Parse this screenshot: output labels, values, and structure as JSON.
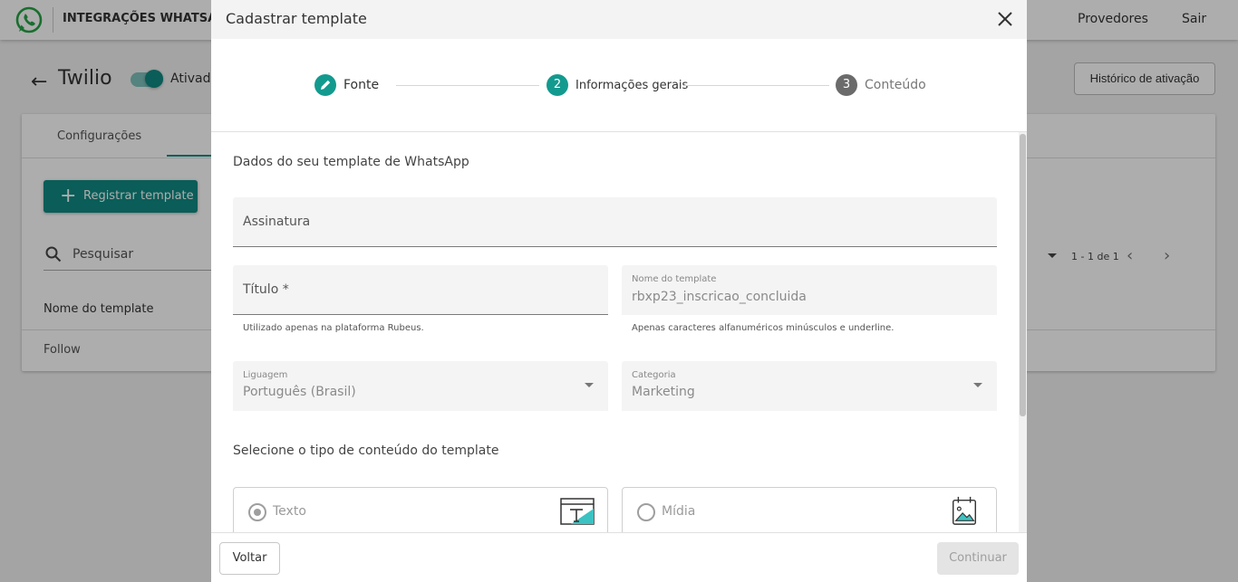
{
  "app": {
    "title": "INTEGRAÇÕES WHATSAPP",
    "nav": {
      "providers": "Provedores",
      "logout": "Sair"
    }
  },
  "provider": {
    "back_icon": "arrow-left-icon",
    "name": "Twilio",
    "status_label": "Ativado",
    "status_on": true,
    "history_button": "Histórico de ativação"
  },
  "card": {
    "tab_config": "Configurações",
    "register_button": "Registrar template",
    "search_placeholder": "Pesquisar",
    "pagination": "1 - 1 de 1",
    "column_header": "Nome do template",
    "rows": [
      "Follow"
    ]
  },
  "modal": {
    "title": "Cadastrar template",
    "steps": [
      {
        "number": "",
        "label": "Fonte",
        "state": "completed",
        "icon": "pencil-icon"
      },
      {
        "number": "2",
        "label": "Informações gerais",
        "state": "active"
      },
      {
        "number": "3",
        "label": "Conteúdo",
        "state": "pending"
      }
    ],
    "section_data_title": "Dados do seu template de WhatsApp",
    "fields": {
      "signature": {
        "placeholder": "Assinatura"
      },
      "title": {
        "placeholder": "Título *",
        "hint": "Utilizado apenas na plataforma Rubeus."
      },
      "template_name": {
        "label": "Nome do template",
        "value": "rbxp23_inscricao_concluida",
        "hint": "Apenas caracteres alfanuméricos minúsculos e underline."
      },
      "language": {
        "label": "Liguagem",
        "value": "Português (Brasil)"
      },
      "category": {
        "label": "Categoria",
        "value": "Marketing"
      }
    },
    "content_section_title": "Selecione o tipo de conteúdo do template",
    "content_options": [
      {
        "label": "Texto",
        "selected": true,
        "icon": "text-template-icon"
      },
      {
        "label": "Mídia",
        "selected": false,
        "icon": "media-template-icon"
      }
    ],
    "footer": {
      "back": "Voltar",
      "continue": "Continuar"
    }
  },
  "colors": {
    "accent": "#0f8a82",
    "step_active": "#139a8f",
    "step_pending": "#6b6b6b",
    "whatsapp": "#25a244"
  }
}
